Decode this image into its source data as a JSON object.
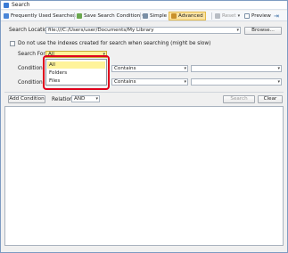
{
  "window": {
    "title": "Search"
  },
  "toolbar": {
    "frequent_label": "Frequently Used Searches",
    "save_label": "Save Search Condition",
    "simple_label": "Simple",
    "advanced_label": "Advanced",
    "reset_label": "Reset",
    "preview_label": "Preview"
  },
  "location": {
    "label": "Search Location:",
    "value": "file:///C:/Users/user/Documents/My Library",
    "browse_label": "Browse..."
  },
  "options": {
    "no_index_label": "Do not use the indexes created for search when searching (might be slow)"
  },
  "search_for": {
    "label": "Search For:",
    "value": "All",
    "options": [
      "All",
      "Folders",
      "Files"
    ]
  },
  "conditions": [
    {
      "label": "Condition:",
      "operator": "Contains"
    },
    {
      "label": "Condition:",
      "operator": "Contains"
    }
  ],
  "actions": {
    "add_condition_label": "Add Condition",
    "relation_label": "Relation:",
    "relation_value": "AND",
    "search_label": "Search",
    "clear_label": "Clear"
  }
}
